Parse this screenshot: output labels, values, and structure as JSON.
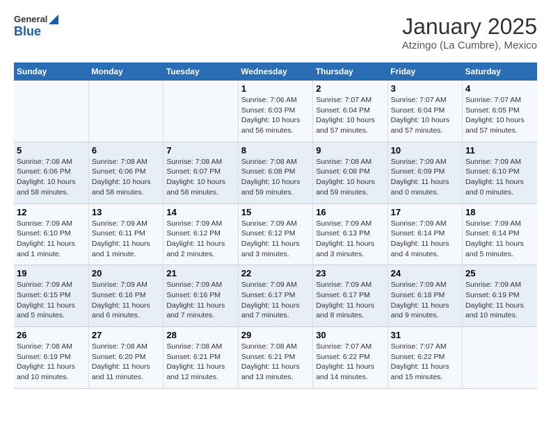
{
  "logo": {
    "general": "General",
    "blue": "Blue"
  },
  "title": "January 2025",
  "subtitle": "Atzingo (La Cumbre), Mexico",
  "headers": [
    "Sunday",
    "Monday",
    "Tuesday",
    "Wednesday",
    "Thursday",
    "Friday",
    "Saturday"
  ],
  "weeks": [
    [
      {
        "day": "",
        "info": ""
      },
      {
        "day": "",
        "info": ""
      },
      {
        "day": "",
        "info": ""
      },
      {
        "day": "1",
        "info": "Sunrise: 7:06 AM\nSunset: 6:03 PM\nDaylight: 10 hours\nand 56 minutes."
      },
      {
        "day": "2",
        "info": "Sunrise: 7:07 AM\nSunset: 6:04 PM\nDaylight: 10 hours\nand 57 minutes."
      },
      {
        "day": "3",
        "info": "Sunrise: 7:07 AM\nSunset: 6:04 PM\nDaylight: 10 hours\nand 57 minutes."
      },
      {
        "day": "4",
        "info": "Sunrise: 7:07 AM\nSunset: 6:05 PM\nDaylight: 10 hours\nand 57 minutes."
      }
    ],
    [
      {
        "day": "5",
        "info": "Sunrise: 7:08 AM\nSunset: 6:06 PM\nDaylight: 10 hours\nand 58 minutes."
      },
      {
        "day": "6",
        "info": "Sunrise: 7:08 AM\nSunset: 6:06 PM\nDaylight: 10 hours\nand 58 minutes."
      },
      {
        "day": "7",
        "info": "Sunrise: 7:08 AM\nSunset: 6:07 PM\nDaylight: 10 hours\nand 58 minutes."
      },
      {
        "day": "8",
        "info": "Sunrise: 7:08 AM\nSunset: 6:08 PM\nDaylight: 10 hours\nand 59 minutes."
      },
      {
        "day": "9",
        "info": "Sunrise: 7:08 AM\nSunset: 6:08 PM\nDaylight: 10 hours\nand 59 minutes."
      },
      {
        "day": "10",
        "info": "Sunrise: 7:09 AM\nSunset: 6:09 PM\nDaylight: 11 hours\nand 0 minutes."
      },
      {
        "day": "11",
        "info": "Sunrise: 7:09 AM\nSunset: 6:10 PM\nDaylight: 11 hours\nand 0 minutes."
      }
    ],
    [
      {
        "day": "12",
        "info": "Sunrise: 7:09 AM\nSunset: 6:10 PM\nDaylight: 11 hours\nand 1 minute."
      },
      {
        "day": "13",
        "info": "Sunrise: 7:09 AM\nSunset: 6:11 PM\nDaylight: 11 hours\nand 1 minute."
      },
      {
        "day": "14",
        "info": "Sunrise: 7:09 AM\nSunset: 6:12 PM\nDaylight: 11 hours\nand 2 minutes."
      },
      {
        "day": "15",
        "info": "Sunrise: 7:09 AM\nSunset: 6:12 PM\nDaylight: 11 hours\nand 3 minutes."
      },
      {
        "day": "16",
        "info": "Sunrise: 7:09 AM\nSunset: 6:13 PM\nDaylight: 11 hours\nand 3 minutes."
      },
      {
        "day": "17",
        "info": "Sunrise: 7:09 AM\nSunset: 6:14 PM\nDaylight: 11 hours\nand 4 minutes."
      },
      {
        "day": "18",
        "info": "Sunrise: 7:09 AM\nSunset: 6:14 PM\nDaylight: 11 hours\nand 5 minutes."
      }
    ],
    [
      {
        "day": "19",
        "info": "Sunrise: 7:09 AM\nSunset: 6:15 PM\nDaylight: 11 hours\nand 5 minutes."
      },
      {
        "day": "20",
        "info": "Sunrise: 7:09 AM\nSunset: 6:16 PM\nDaylight: 11 hours\nand 6 minutes."
      },
      {
        "day": "21",
        "info": "Sunrise: 7:09 AM\nSunset: 6:16 PM\nDaylight: 11 hours\nand 7 minutes."
      },
      {
        "day": "22",
        "info": "Sunrise: 7:09 AM\nSunset: 6:17 PM\nDaylight: 11 hours\nand 7 minutes."
      },
      {
        "day": "23",
        "info": "Sunrise: 7:09 AM\nSunset: 6:17 PM\nDaylight: 11 hours\nand 8 minutes."
      },
      {
        "day": "24",
        "info": "Sunrise: 7:09 AM\nSunset: 6:18 PM\nDaylight: 11 hours\nand 9 minutes."
      },
      {
        "day": "25",
        "info": "Sunrise: 7:09 AM\nSunset: 6:19 PM\nDaylight: 11 hours\nand 10 minutes."
      }
    ],
    [
      {
        "day": "26",
        "info": "Sunrise: 7:08 AM\nSunset: 6:19 PM\nDaylight: 11 hours\nand 10 minutes."
      },
      {
        "day": "27",
        "info": "Sunrise: 7:08 AM\nSunset: 6:20 PM\nDaylight: 11 hours\nand 11 minutes."
      },
      {
        "day": "28",
        "info": "Sunrise: 7:08 AM\nSunset: 6:21 PM\nDaylight: 11 hours\nand 12 minutes."
      },
      {
        "day": "29",
        "info": "Sunrise: 7:08 AM\nSunset: 6:21 PM\nDaylight: 11 hours\nand 13 minutes."
      },
      {
        "day": "30",
        "info": "Sunrise: 7:07 AM\nSunset: 6:22 PM\nDaylight: 11 hours\nand 14 minutes."
      },
      {
        "day": "31",
        "info": "Sunrise: 7:07 AM\nSunset: 6:22 PM\nDaylight: 11 hours\nand 15 minutes."
      },
      {
        "day": "",
        "info": ""
      }
    ]
  ]
}
